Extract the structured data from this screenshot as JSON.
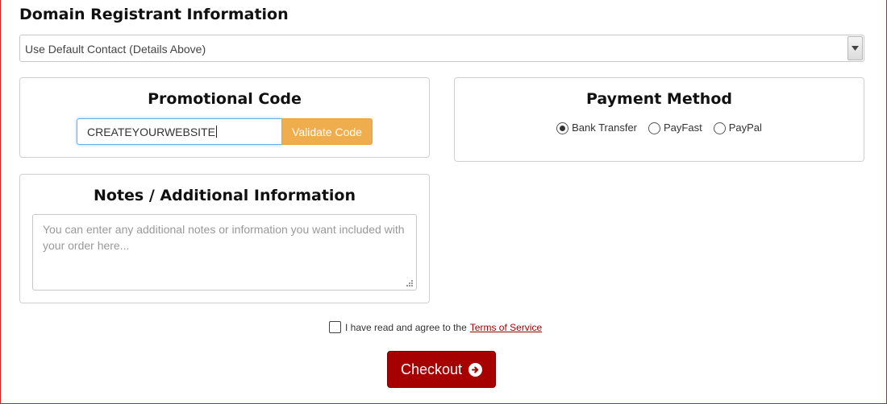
{
  "registrant": {
    "title": "Domain Registrant Information",
    "select_value": "Use Default Contact (Details Above)",
    "arrow_icon": "chevron-down-icon"
  },
  "promo": {
    "title": "Promotional Code",
    "input_value": "CREATEYOURWEBSITE",
    "button_label": "Validate Code"
  },
  "payment": {
    "title": "Payment Method",
    "options": [
      {
        "label": "Bank Transfer",
        "checked": true
      },
      {
        "label": "PayFast",
        "checked": false
      },
      {
        "label": "PayPal",
        "checked": false
      }
    ]
  },
  "notes": {
    "title": "Notes / Additional Information",
    "placeholder": "You can enter any additional notes or information you want included with your order here..."
  },
  "agreement": {
    "text": "I have read and agree to the",
    "link_text": "Terms of Service",
    "checked": false
  },
  "checkout": {
    "label": "Checkout",
    "icon": "arrow-circle-right-icon"
  },
  "colors": {
    "accent": "#f0ad4e",
    "checkout": "#a70000",
    "link": "#990000",
    "frame": "#cc2222"
  }
}
